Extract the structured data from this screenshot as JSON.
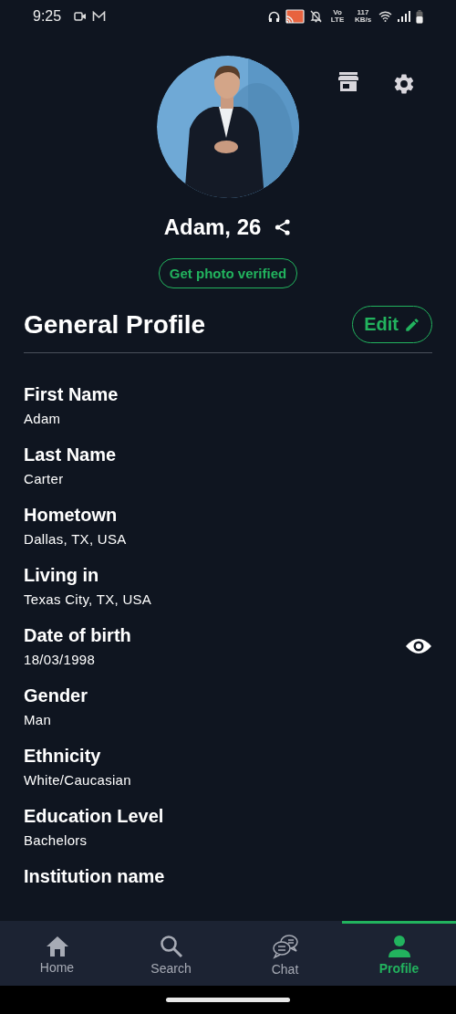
{
  "status_bar": {
    "time": "9:25",
    "network": "Vo LTE",
    "speed": "117 KB/s"
  },
  "profile": {
    "name": "Adam, 26",
    "verify_button": "Get photo verified"
  },
  "section": {
    "title": "General Profile",
    "edit_button": "Edit"
  },
  "fields": [
    {
      "label": "First Name",
      "value": "Adam",
      "visibility_toggle": false
    },
    {
      "label": "Last Name",
      "value": "Carter",
      "visibility_toggle": false
    },
    {
      "label": "Hometown",
      "value": "Dallas, TX, USA",
      "visibility_toggle": false
    },
    {
      "label": "Living in",
      "value": "Texas City, TX, USA",
      "visibility_toggle": false
    },
    {
      "label": "Date of birth",
      "value": "18/03/1998",
      "visibility_toggle": true
    },
    {
      "label": "Gender",
      "value": "Man",
      "visibility_toggle": false
    },
    {
      "label": "Ethnicity",
      "value": "White/Caucasian",
      "visibility_toggle": false
    },
    {
      "label": "Education Level",
      "value": "Bachelors",
      "visibility_toggle": false
    },
    {
      "label": "Institution name",
      "visibility_toggle": false
    }
  ],
  "nav": [
    {
      "label": "Home",
      "kind": "home",
      "selected": false
    },
    {
      "label": "Search",
      "kind": "search",
      "selected": false
    },
    {
      "label": "Chat",
      "kind": "chat",
      "selected": false
    },
    {
      "label": "Profile",
      "kind": "profile",
      "selected": true
    }
  ]
}
